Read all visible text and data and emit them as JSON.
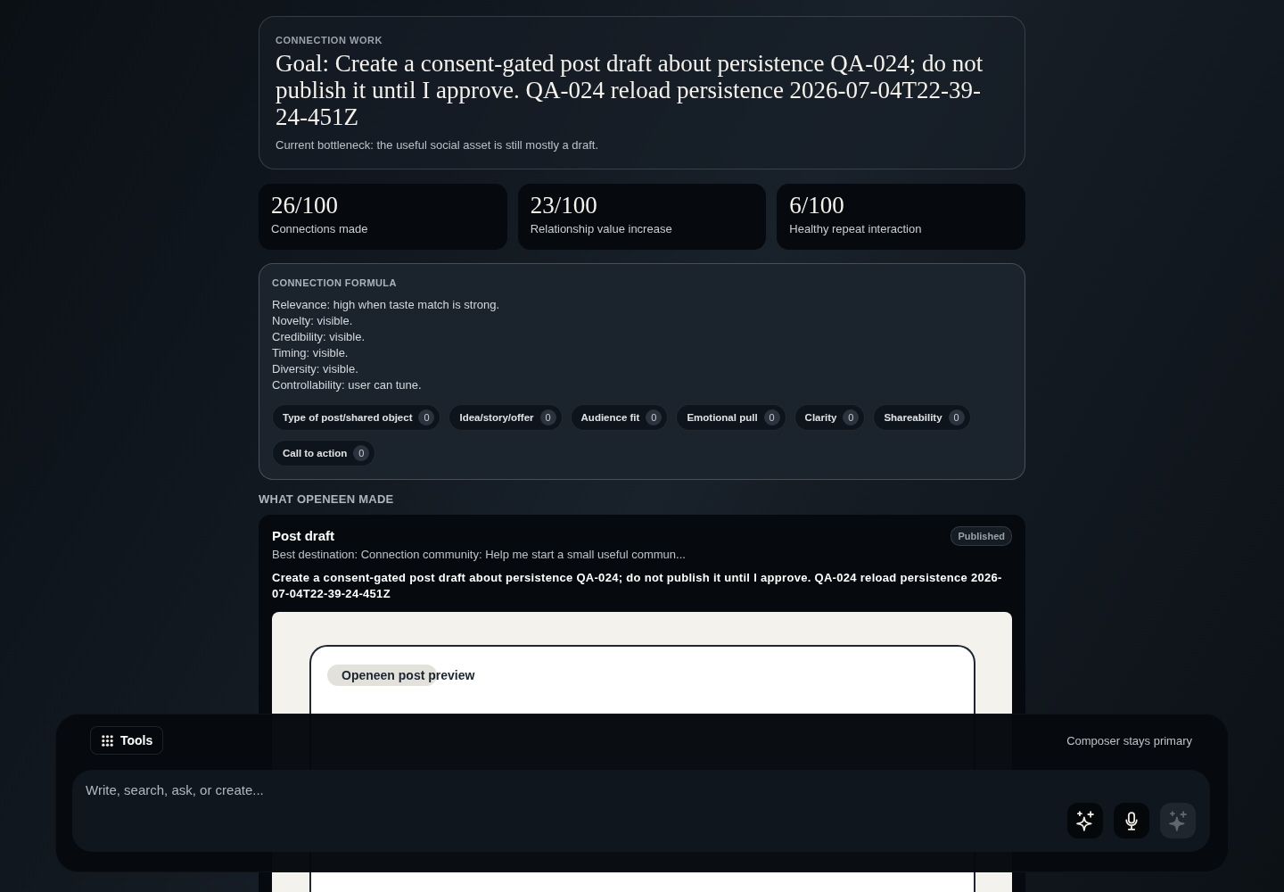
{
  "goal_card": {
    "label": "CONNECTION WORK",
    "goal": "Goal: Create a consent-gated post draft about persistence QA-024; do not publish it until I approve. QA-024 reload persistence 2026-07-04T22-39-24-451Z",
    "bottleneck": "Current bottleneck: the useful social asset is still mostly a draft."
  },
  "stats": [
    {
      "value": "26/100",
      "label": "Connections made"
    },
    {
      "value": "23/100",
      "label": "Relationship value increase"
    },
    {
      "value": "6/100",
      "label": "Healthy repeat interaction"
    }
  ],
  "formula": {
    "label": "CONNECTION FORMULA",
    "lines": [
      "Relevance: high when taste match is strong.",
      "Novelty: visible.",
      "Credibility: visible.",
      "Timing: visible.",
      "Diversity: visible.",
      "Controllability: user can tune."
    ],
    "factors": [
      {
        "label": "Type of post/shared object",
        "count": "0"
      },
      {
        "label": "Idea/story/offer",
        "count": "0"
      },
      {
        "label": "Audience fit",
        "count": "0"
      },
      {
        "label": "Emotional pull",
        "count": "0"
      },
      {
        "label": "Clarity",
        "count": "0"
      },
      {
        "label": "Shareability",
        "count": "0"
      },
      {
        "label": "Call to action",
        "count": "0"
      }
    ]
  },
  "made": {
    "heading": "WHAT OPENEEN MADE",
    "items": [
      {
        "title": "Post draft",
        "status": "Published",
        "destination": "Best destination: Connection community: Help me start a small useful commun...",
        "body": "Create a consent-gated post draft about persistence QA-024; do not publish it until I approve. QA-024 reload persistence 2026-07-04T22-39-24-451Z",
        "preview": {
          "label": "Openeen post preview"
        }
      }
    ]
  },
  "composer": {
    "tools_button": "Tools",
    "note": "Composer stays primary",
    "input": {
      "placeholder": "Write, search, ask, or create..."
    },
    "actions": [
      {
        "kind": "sparkles",
        "disabled": false
      },
      {
        "kind": "mic",
        "disabled": false
      },
      {
        "kind": "sparkles",
        "disabled": true
      }
    ]
  }
}
